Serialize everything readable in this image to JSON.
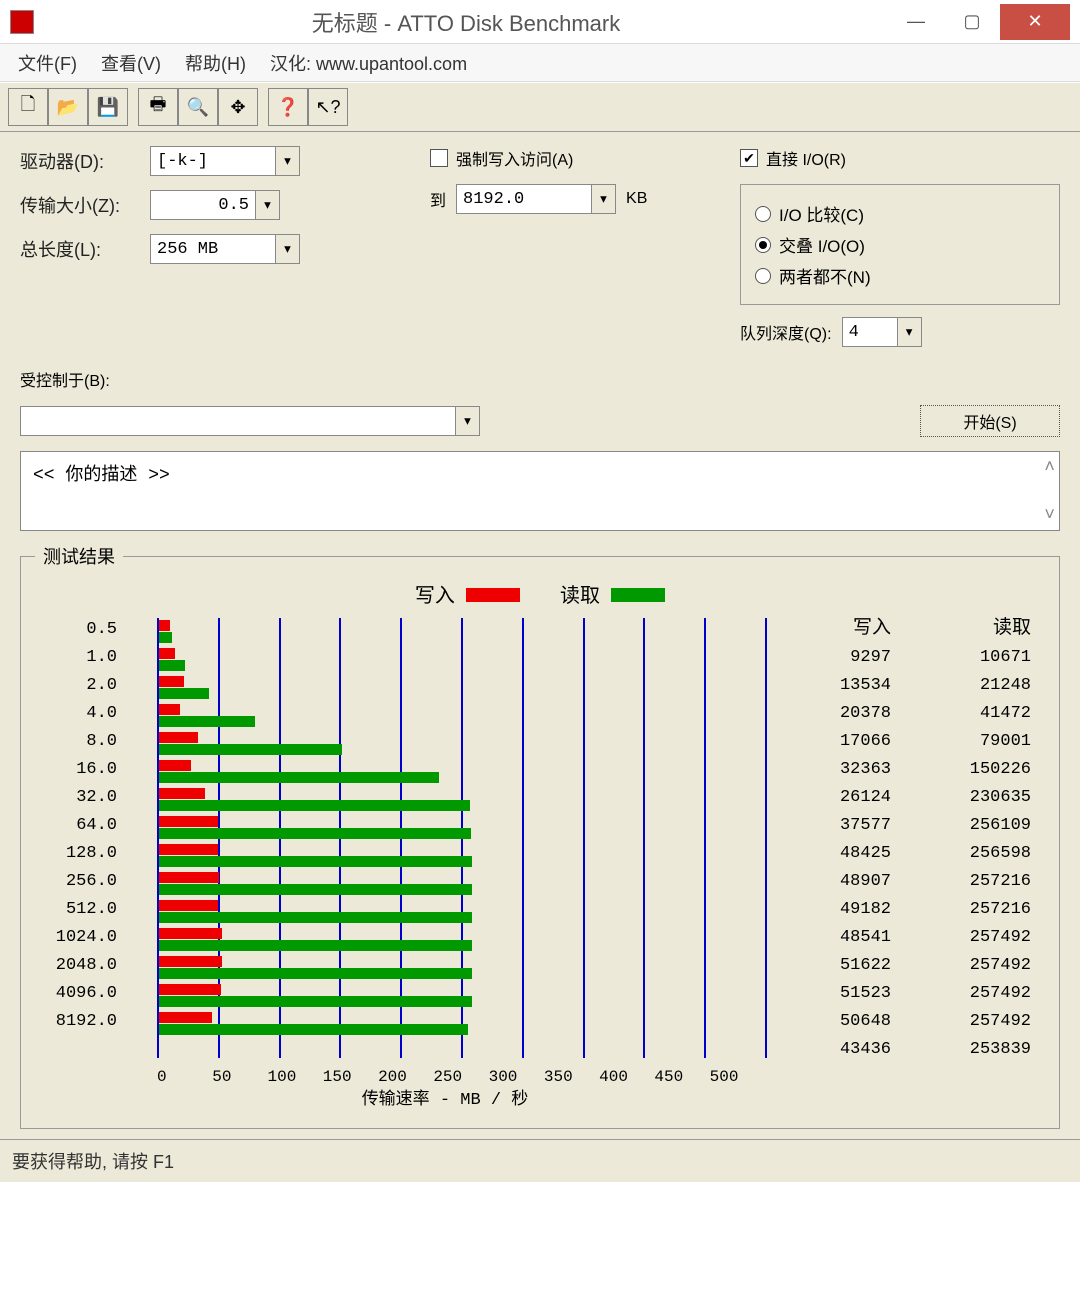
{
  "window": {
    "title": "无标题 - ATTO Disk Benchmark"
  },
  "menu": {
    "file": "文件(F)",
    "view": "查看(V)",
    "help": "帮助(H)",
    "credit": "汉化: www.upantool.com"
  },
  "labels": {
    "drive": "驱动器(D):",
    "transfer": "传输大小(Z):",
    "to": "到",
    "kb": "KB",
    "length": "总长度(L):",
    "force": "强制写入访问(A)",
    "direct": "直接 I/O(R)",
    "compare": "I/O 比较(C)",
    "overlap": "交叠 I/O(O)",
    "neither": "两者都不(N)",
    "queue": "队列深度(Q):",
    "controlled": "受控制于(B):",
    "start": "开始(S)",
    "desc": "<<  你的描述   >>",
    "results": "测试结果",
    "write": "写入",
    "read": "读取",
    "xlabel": "传输速率 - MB / 秒",
    "status": "要获得帮助, 请按 F1"
  },
  "values": {
    "drive": "[-k-]",
    "from": "0.5",
    "to": "8192.0",
    "length": "256 MB",
    "queue": "4"
  },
  "axis_ticks": [
    "0",
    "50",
    "100",
    "150",
    "200",
    "250",
    "300",
    "350",
    "400",
    "450",
    "500"
  ],
  "chart_data": {
    "type": "bar",
    "title": "测试结果",
    "xlabel": "传输速率 - MB / 秒",
    "ylabel": "",
    "xlim": [
      0,
      500
    ],
    "categories": [
      "0.5",
      "1.0",
      "2.0",
      "4.0",
      "8.0",
      "16.0",
      "32.0",
      "64.0",
      "128.0",
      "256.0",
      "512.0",
      "1024.0",
      "2048.0",
      "4096.0",
      "8192.0"
    ],
    "series": [
      {
        "name": "写入",
        "values": [
          9297,
          13534,
          20378,
          17066,
          32363,
          26124,
          37577,
          48425,
          48907,
          49182,
          48541,
          51622,
          51523,
          50648,
          43436
        ]
      },
      {
        "name": "读取",
        "values": [
          10671,
          21248,
          41472,
          79001,
          150226,
          230635,
          256109,
          256598,
          257216,
          257216,
          257492,
          257492,
          257492,
          257492,
          253839
        ]
      }
    ]
  }
}
